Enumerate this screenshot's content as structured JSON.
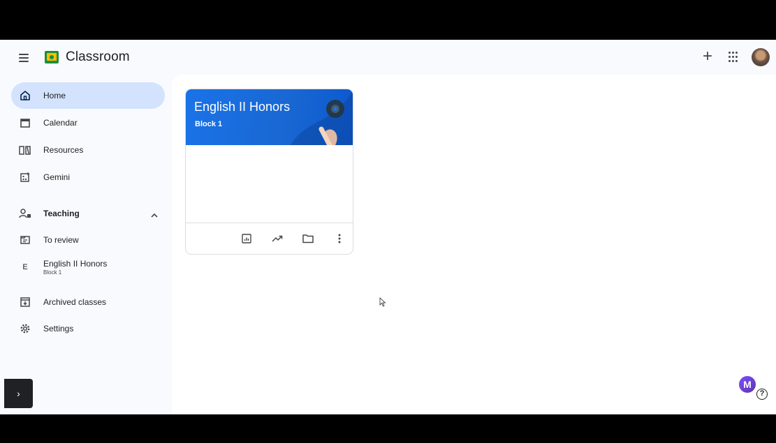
{
  "app": {
    "title": "Classroom"
  },
  "sidebar": {
    "items": [
      {
        "label": "Home",
        "icon": "home-icon",
        "active": true
      },
      {
        "label": "Calendar",
        "icon": "calendar-icon"
      },
      {
        "label": "Resources",
        "icon": "resources-icon"
      },
      {
        "label": "Gemini",
        "icon": "gemini-icon"
      }
    ],
    "teaching": {
      "label": "Teaching",
      "icon": "teaching-icon",
      "items": [
        {
          "label": "To review",
          "icon": "to-review-icon"
        },
        {
          "label": "English II Honors",
          "sub": "Block 1",
          "initial": "E"
        }
      ]
    },
    "bottom_items": [
      {
        "label": "Archived classes",
        "icon": "archive-icon"
      },
      {
        "label": "Settings",
        "icon": "settings-icon"
      }
    ]
  },
  "class_card": {
    "title": "English II Honors",
    "section": "Block 1"
  },
  "widgets": {
    "m_badge": "M",
    "help": "?",
    "expand": "›"
  },
  "colors": {
    "accent_active": "#d3e3fd",
    "banner": "#1967d2",
    "logo_green": "#1e8e3e",
    "logo_yellow": "#fbbc04"
  }
}
